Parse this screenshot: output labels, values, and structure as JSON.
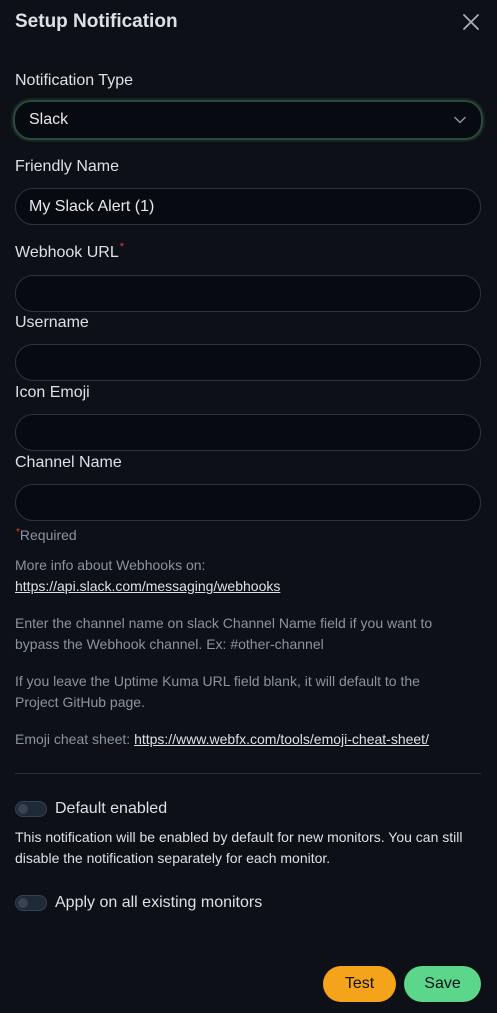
{
  "header": {
    "title": "Setup Notification"
  },
  "notification_type": {
    "label": "Notification Type",
    "value": "Slack"
  },
  "friendly_name": {
    "label": "Friendly Name",
    "value": "My Slack Alert (1)"
  },
  "webhook_url": {
    "label": "Webhook URL",
    "required_mark": "*",
    "value": ""
  },
  "username": {
    "label": "Username",
    "value": ""
  },
  "icon_emoji": {
    "label": "Icon Emoji",
    "value": ""
  },
  "channel_name": {
    "label": "Channel Name",
    "value": ""
  },
  "required_note": {
    "mark": "*",
    "text": "Required"
  },
  "info": {
    "webhooks_text": "More info about Webhooks on:",
    "webhooks_link": "https://api.slack.com/messaging/webhooks",
    "channel_hint": "Enter the channel name on slack Channel Name field if you want to bypass the Webhook channel. Ex: #other-channel",
    "uptime_hint": "If you leave the Uptime Kuma URL field blank, it will default to the Project GitHub page.",
    "emoji_text": "Emoji cheat sheet: ",
    "emoji_link": "https://www.webfx.com/tools/emoji-cheat-sheet/"
  },
  "default_enabled": {
    "label": "Default enabled",
    "description": "This notification will be enabled by default for new monitors. You can still disable the notification separately for each monitor."
  },
  "apply_existing": {
    "label": "Apply on all existing monitors"
  },
  "buttons": {
    "test": "Test",
    "save": "Save"
  },
  "colors": {
    "test": "#f5a31a",
    "save": "#5cd68a",
    "background": "#0d1117",
    "required": "#e33333"
  }
}
